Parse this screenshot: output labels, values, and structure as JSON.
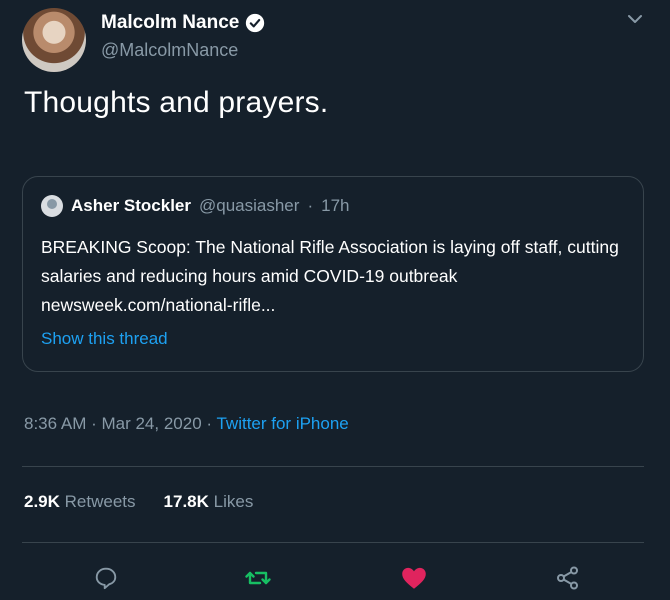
{
  "author": {
    "display_name": "Malcolm Nance",
    "handle": "@MalcolmNance"
  },
  "tweet": {
    "text": "Thoughts and prayers."
  },
  "quoted": {
    "display_name": "Asher Stockler",
    "handle": "@quasiasher",
    "separator": "·",
    "time": "17h",
    "text": "BREAKING Scoop: The National Rifle Association is laying off staff, cutting salaries and reducing hours amid COVID-19 outbreak newsweek.com/national-rifle...",
    "show_thread_label": "Show this thread"
  },
  "meta": {
    "time_date": "8:36 AM · Mar 24, 2020",
    "separator": " · ",
    "source": "Twitter for iPhone"
  },
  "stats": {
    "retweets_count": "2.9K",
    "retweets_label": "Retweets",
    "likes_count": "17.8K",
    "likes_label": "Likes"
  },
  "icons": {
    "verified": "verified-badge-icon",
    "menu": "chevron-down-icon",
    "reply": "reply-icon",
    "retweet": "retweet-icon",
    "like": "heart-icon",
    "share": "share-icon"
  },
  "colors": {
    "background": "#15202b",
    "accent": "#1da1f2",
    "muted": "#8899a6",
    "retweet_active": "#17bf63",
    "like_active": "#e0245e"
  }
}
